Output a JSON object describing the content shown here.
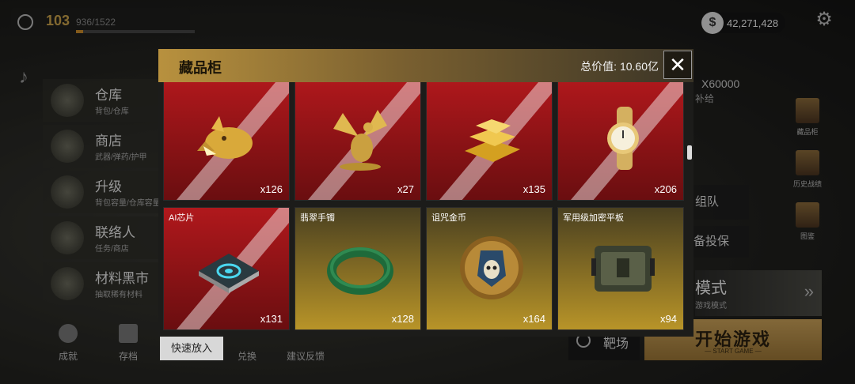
{
  "player": {
    "level": "103",
    "xp": "936/1522",
    "xp_progress": 0.06
  },
  "currency": {
    "symbol": "$",
    "amount": "42,271,428"
  },
  "menu": [
    {
      "title": "仓库",
      "sub": "背包/仓库"
    },
    {
      "title": "商店",
      "sub": "武器/弹药/护甲"
    },
    {
      "title": "升级",
      "sub": "背包容量/仓库容量"
    },
    {
      "title": "联络人",
      "sub": "任务/商店"
    },
    {
      "title": "材料黑市",
      "sub": "抽取稀有材料"
    }
  ],
  "bottom_bar": [
    {
      "label": "成就"
    },
    {
      "label": "存档"
    },
    {
      "label": "兑换"
    },
    {
      "label": "建议反馈"
    }
  ],
  "right_panel": {
    "supply_amount": "X60000",
    "supply_label": "补给",
    "side_icons": [
      {
        "label": "藏品柜",
        "icon": "cabinet-icon"
      },
      {
        "label": "历史战绩",
        "icon": "scroll-icon"
      },
      {
        "label": "图鉴",
        "icon": "book-icon"
      }
    ],
    "team_label": "组队",
    "insure_label": "备投保",
    "mode_title": "模式",
    "mode_sub": "游戏模式",
    "range_label": "靶场",
    "start_label": "开始游戏",
    "start_sub": "— START GAME —"
  },
  "modal": {
    "title": "藏品柜",
    "total_value": "总价值: 10.60亿",
    "quick_put": "快速放入",
    "items": [
      {
        "name": "",
        "count": "x126",
        "rarity": "red",
        "icon": "golden-wolf-head-icon"
      },
      {
        "name": "",
        "count": "x27",
        "rarity": "red",
        "icon": "golden-dragon-statue-icon"
      },
      {
        "name": "",
        "count": "x135",
        "rarity": "red",
        "icon": "gold-bars-icon"
      },
      {
        "name": "",
        "count": "x206",
        "rarity": "red",
        "icon": "gold-watch-icon"
      },
      {
        "name": "AI芯片",
        "count": "x131",
        "rarity": "red",
        "icon": "ai-chip-icon"
      },
      {
        "name": "翡翠手镯",
        "count": "x128",
        "rarity": "gold",
        "icon": "jade-bracelet-icon"
      },
      {
        "name": "诅咒金币",
        "count": "x164",
        "rarity": "gold",
        "icon": "cursed-coin-icon"
      },
      {
        "name": "军用级加密平板",
        "count": "x94",
        "rarity": "gold",
        "icon": "military-tablet-icon"
      }
    ]
  }
}
